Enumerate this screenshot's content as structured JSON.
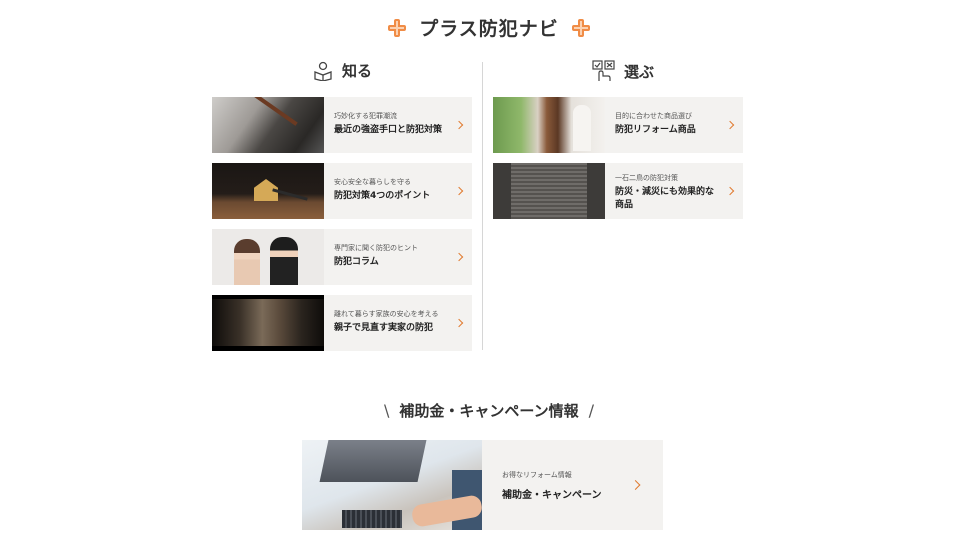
{
  "header": {
    "title": "プラス防犯ナビ"
  },
  "sections": {
    "learn": {
      "label": "知る",
      "items": [
        {
          "sub": "巧妙化する犯罪潮流",
          "title": "最近の強盗手口と防犯対策"
        },
        {
          "sub": "安心安全な暮らしを守る",
          "title": "防犯対策4つのポイント"
        },
        {
          "sub": "専門家に聞く防犯のヒント",
          "title": "防犯コラム"
        },
        {
          "sub": "離れて暮らす家族の安心を考える",
          "title": "親子で見直す実家の防犯"
        }
      ]
    },
    "choose": {
      "label": "選ぶ",
      "items": [
        {
          "sub": "目的に合わせた商品選び",
          "title": "防犯リフォーム商品"
        },
        {
          "sub": "一石二鳥の防犯対策",
          "title": "防災・減災にも効果的な商品"
        }
      ]
    }
  },
  "campaign": {
    "heading": "補助金・キャンペーン情報",
    "slash_left": "\\",
    "slash_right": "/",
    "card": {
      "sub": "お得なリフォーム情報",
      "title": "補助金・キャンペーン"
    }
  },
  "colors": {
    "accent": "#e07a2f",
    "card_bg": "#f3f2f0",
    "text": "#333333"
  },
  "icons": {
    "title": "plus-cross-icon",
    "learn": "reading-person-icon",
    "choose": "checklist-hand-icon",
    "chevron": "chevron-right-icon"
  }
}
